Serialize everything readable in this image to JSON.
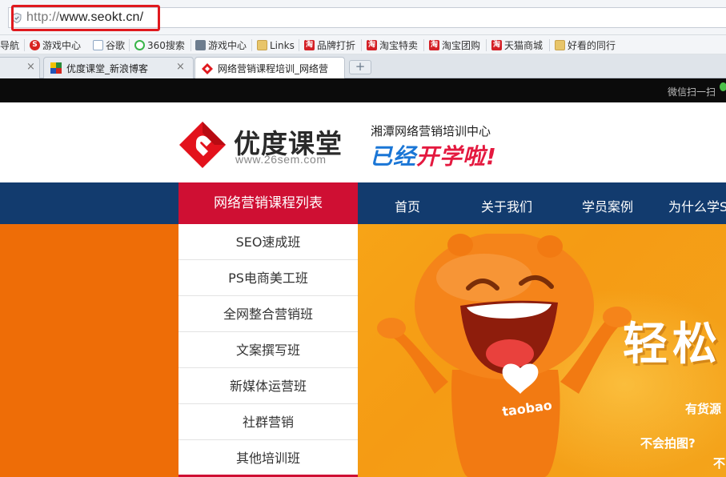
{
  "browser": {
    "url_prefix": "http://",
    "url_host": "www.seokt.cn/",
    "bookmarks": [
      {
        "label": "导航",
        "icon": "none"
      },
      {
        "label": "游戏中心",
        "icon": "red-circle-icon"
      },
      {
        "label": "谷歌",
        "icon": "page-icon"
      },
      {
        "label": "360搜索",
        "icon": "360-icon"
      },
      {
        "label": "游戏中心",
        "icon": "gamepad-icon"
      },
      {
        "label": "Links",
        "icon": "folder-icon"
      },
      {
        "label": "品牌打折",
        "icon": "taobao-icon"
      },
      {
        "label": "淘宝特卖",
        "icon": "taobao-icon"
      },
      {
        "label": "淘宝团购",
        "icon": "taobao-icon"
      },
      {
        "label": "天猫商城",
        "icon": "taobao-icon"
      },
      {
        "label": "好看的同行",
        "icon": "folder-icon"
      }
    ],
    "tabs": [
      {
        "label": "优度课堂_新浪博客",
        "active": false
      },
      {
        "label": "网络营销课程培训_网络营",
        "active": true
      }
    ],
    "new_tab_label": "+",
    "tab_close_label": "×"
  },
  "site": {
    "wechat_text": "微信扫一扫",
    "logo_title": "优度课堂",
    "logo_url": "www.26sem.com",
    "slogan_top": "湘潭网络营销培训中心",
    "slogan_part1": "已经",
    "slogan_part2": "开学啦!",
    "nav_category": "网络营销课程列表",
    "nav_items": [
      "首页",
      "关于我们",
      "学员案例",
      "为什么学SEO"
    ],
    "menu_items": [
      "SEO速成班",
      "PS电商美工班",
      "全网整合营销班",
      "文案撰写班",
      "新媒体运营班",
      "社群营销",
      "其他培训班"
    ],
    "hero": {
      "headline": "轻松",
      "line1": "有货源",
      "line2": "不会拍图?",
      "line3": "不"
    },
    "mascot_badge": "taobao",
    "colors": {
      "nav_bg": "#123b6e",
      "nav_category_bg": "#cf0f33",
      "hero_orange": "#ee6d07",
      "hero_yellow": "#f7a417",
      "highlight_red": "#e0191e"
    }
  }
}
